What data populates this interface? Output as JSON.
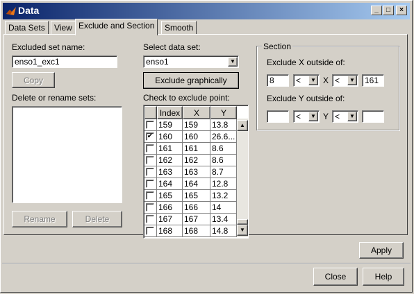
{
  "window": {
    "title": "Data",
    "minimize": "_",
    "maximize": "□",
    "close": "×"
  },
  "tabs": [
    "Data Sets",
    "View",
    "Exclude and Section",
    "Smooth"
  ],
  "left": {
    "excluded_label": "Excluded set name:",
    "excluded_value": "enso1_exc1",
    "copy_label": "Copy",
    "delete_rename_label": "Delete or rename sets:",
    "rename_label": "Rename",
    "delete_label": "Delete"
  },
  "middle": {
    "select_label": "Select data set:",
    "select_value": "enso1",
    "exclude_graphically": "Exclude graphically",
    "check_label": "Check to exclude point:",
    "columns": [
      "Index",
      "X",
      "Y"
    ],
    "rows": [
      {
        "index": "159",
        "x": "159",
        "y": "13.8",
        "checked": false
      },
      {
        "index": "160",
        "x": "160",
        "y": "26.6...",
        "checked": true
      },
      {
        "index": "161",
        "x": "161",
        "y": "8.6",
        "checked": false
      },
      {
        "index": "162",
        "x": "162",
        "y": "8.6",
        "checked": false
      },
      {
        "index": "163",
        "x": "163",
        "y": "8.7",
        "checked": false
      },
      {
        "index": "164",
        "x": "164",
        "y": "12.8",
        "checked": false
      },
      {
        "index": "165",
        "x": "165",
        "y": "13.2",
        "checked": false
      },
      {
        "index": "166",
        "x": "166",
        "y": "14",
        "checked": false
      },
      {
        "index": "167",
        "x": "167",
        "y": "13.4",
        "checked": false
      },
      {
        "index": "168",
        "x": "168",
        "y": "14.8",
        "checked": false
      }
    ]
  },
  "section": {
    "legend": "Section",
    "x_label": "Exclude X outside of:",
    "x_min": "8",
    "x_op1": "<",
    "x_var": "X",
    "x_op2": "<",
    "x_max": "161",
    "y_label": "Exclude Y outside of:",
    "y_min": "",
    "y_op1": "<",
    "y_var": "Y",
    "y_op2": "<",
    "y_max": ""
  },
  "buttons": {
    "apply": "Apply",
    "close": "Close",
    "help": "Help"
  }
}
